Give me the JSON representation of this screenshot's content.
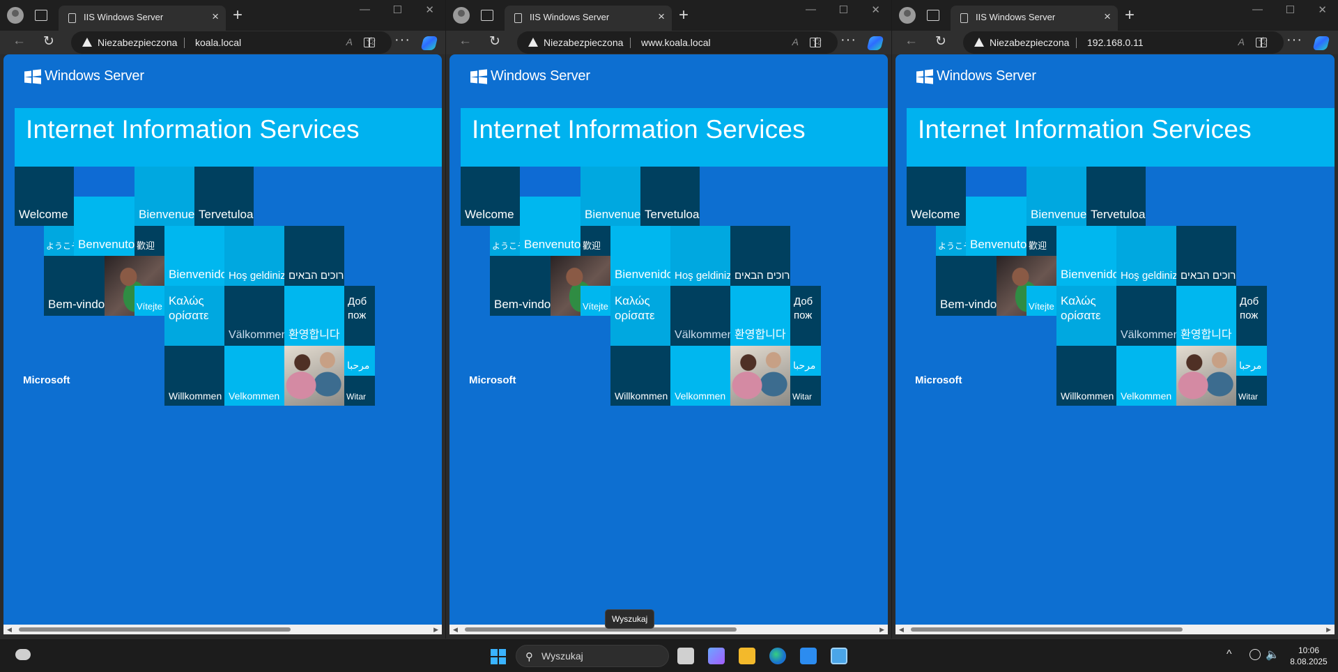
{
  "windows": [
    {
      "tab_title": "IIS Windows Server",
      "security_label": "Niezabezpieczona",
      "url": "koala.local"
    },
    {
      "tab_title": "IIS Windows Server",
      "security_label": "Niezabezpieczona",
      "url": "www.koala.local"
    },
    {
      "tab_title": "IIS Windows Server",
      "security_label": "Niezabezpieczona",
      "url": "192.168.0.11"
    }
  ],
  "page": {
    "brand": "Windows Server",
    "banner": "Internet Information Services",
    "footer": "Microsoft",
    "tiles": {
      "welcome": "Welcome",
      "bienvenue": "Bienvenue",
      "tervetuloa": "Tervetuloa",
      "youkoso": "ようこそ",
      "benvenuto": "Benvenuto",
      "huanying": "歡迎",
      "bienvenido": "Bienvenido",
      "hos_geldiniz": "Hoş geldiniz",
      "brukhim": "ברוכים הבאים",
      "bem_vindo": "Bem-vindo",
      "vitejte": "Vítejte",
      "kalos_1": "Καλώς",
      "kalos_2": "ορίσατε",
      "valkommen": "Välkommen",
      "hwanyeong": "환영합니다",
      "dobro_1": "Доб",
      "dobro_2": "пож",
      "marhaban": "مرحبا",
      "willkommen": "Willkommen",
      "velkommen": "Velkommen",
      "witamy": "Witar"
    }
  },
  "taskbar": {
    "search_placeholder": "Wyszukaj",
    "tooltip": "Wyszukaj",
    "time": "10:06",
    "date": "8.08.2025"
  },
  "colors": {
    "page_bg": "#0d6fd1",
    "banner": "#00b2ef",
    "tile_dark": "#00405f",
    "tile_mid": "#00a8e0",
    "tile_light": "#00b7ef"
  },
  "icons": {
    "profile": "profile-icon",
    "tab_actions": "tab-actions-icon",
    "warning": "warning-triangle-icon",
    "favorite": "star-icon",
    "split": "split-screen-icon",
    "more": "more-dots-icon",
    "copilot": "copilot-icon",
    "start": "windows-start-icon",
    "search": "search-icon"
  }
}
